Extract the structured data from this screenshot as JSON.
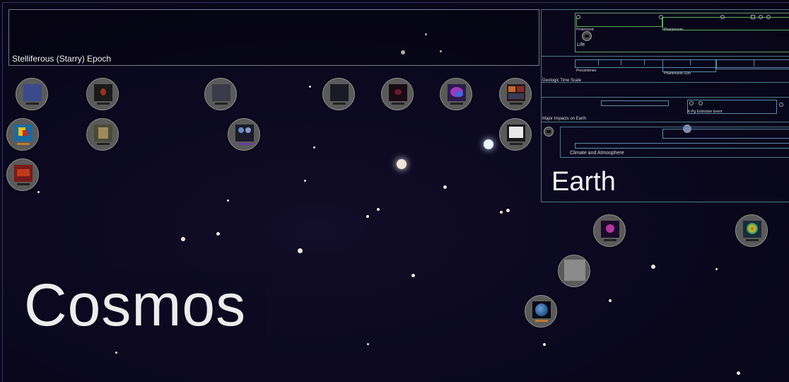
{
  "epoch": {
    "label": "Stelliferous (Starry) Epoch"
  },
  "earth": {
    "title": "Earth",
    "life_label": "Life",
    "life_sub_a": "Proterozoic",
    "life_sub_b": "Phanerozoic",
    "geologic_label": "Geologic Time Scale",
    "geo_sub_a": "Precambrian",
    "geo_sub_b": "Phanerozoic Eon",
    "impacts_label": "Major Impacts on Earth",
    "impacts_sub": "K-Pg Extinction Event",
    "climate_label": "Climate and Atmosphere"
  },
  "cosmos": {
    "label": "Cosmos"
  },
  "nodes": {
    "galaxy_spiral": {
      "thumb": "#3a4a8a"
    },
    "red_nebula": {
      "thumb": "#8a2a1a"
    },
    "star_cluster": {
      "thumb": "#6a6a7a"
    },
    "dark_galaxy": {
      "thumb": "#2a2a3a"
    },
    "red_galaxy": {
      "thumb": "#5a1a2a"
    },
    "pink_blue_cloud": {
      "thumb": "#7a3aa0"
    },
    "multi_panel": {
      "thumb": "#7a4a1a"
    },
    "colorful_map": {
      "thumb": "#1a6aa0"
    },
    "building": {
      "thumb": "#6a6a5a"
    },
    "spiral_diagram": {
      "thumb": "#2a3a6a"
    },
    "white_diagram": {
      "thumb": "#dadada"
    },
    "red_field": {
      "thumb": "#8a1a1a"
    },
    "pink_planet": {
      "thumb": "#8a2a7a"
    },
    "climate_globe": {
      "thumb": "#2a8a6a"
    },
    "gray_surface": {
      "thumb": "#8a8a8a"
    },
    "blue_earth": {
      "thumb": "#2a5a9a"
    }
  }
}
